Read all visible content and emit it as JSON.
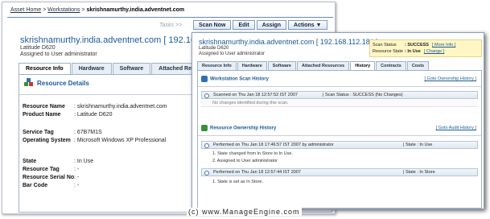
{
  "back_window": {
    "breadcrumb": {
      "home": "Asset Home",
      "sep1": ">",
      "workstations": "Workstations",
      "sep2": ">",
      "current": "skrishnamurthy.india.adventnet.com"
    },
    "tasks_label": "Tasks >>",
    "toolbar": [
      "Scan Now",
      "Edit",
      "Assign",
      "Actions ▼"
    ],
    "hostname": "skrishnamurthy.india.adventnet.com [ 192.168.1",
    "model": "Latitude D620",
    "assigned": "Assigned to User administrator",
    "tabs": [
      "Resource Info",
      "Hardware",
      "Software",
      "Attached Reso"
    ],
    "section_title": "Resource Details",
    "fields": [
      {
        "k": "Resource Name",
        "v": ": skrishnamurthy.india.adventnet.com"
      },
      {
        "k": "Product Name",
        "v": ": Latitude D620"
      },
      {
        "k": "Service Tag",
        "v": ": 67B7M1S"
      },
      {
        "k": "Operating System",
        "v": ": Microsoft Windows XP Professional"
      },
      {
        "k": "State",
        "v": ": In Use"
      },
      {
        "k": "Resource Tag",
        "v": ": -"
      },
      {
        "k": "Resource Serial No",
        "v": ": -"
      },
      {
        "k": "Bar Code",
        "v": ": -"
      }
    ]
  },
  "front_window": {
    "hostname": "skrishnamurthy.india.adventnet.com [ 192.168.112.181 ]",
    "model": "Latitude D620",
    "assigned": "Assigned to User administrator",
    "status_box": {
      "scan_label": "Scan Status",
      "scan_value": ": SUCCESS",
      "scan_link": "[ More Info ]",
      "state_label": "Resource State",
      "state_value": ": In Use",
      "state_link": "[ Change ]"
    },
    "tabs": [
      "Resource Info",
      "Hardware",
      "Software",
      "Attached Resources",
      "History",
      "Contracts",
      "Costs"
    ],
    "scan_history": {
      "title": "Workstation Scan History",
      "link": "[ Goto Ownership History ]",
      "row": "Scanned on Thu Jan 18 12:57:52 IST 2007",
      "row_status": "|  Scan Status : SUCCESS (No Changes)",
      "note": "No changes identified during this scan."
    },
    "ownership_history": {
      "title": "Resource Ownership History",
      "link": "[ Goto Audit History ]",
      "entries": [
        {
          "performed": "Performed on Thu Jan 18 17:46:57 IST 2007 by administrator",
          "state": "|  State : In Use",
          "items": [
            "1.   State changed from In Store to In Use.",
            "2.   Assigned to User administrator"
          ]
        },
        {
          "performed": "Performed on Thu Jan 18 12:57:44 IST 2007",
          "state": "|  State : In Store",
          "items": [
            "1.   State is set as In Store."
          ]
        }
      ]
    }
  },
  "watermark": "(c) www.ManageEngine.com"
}
